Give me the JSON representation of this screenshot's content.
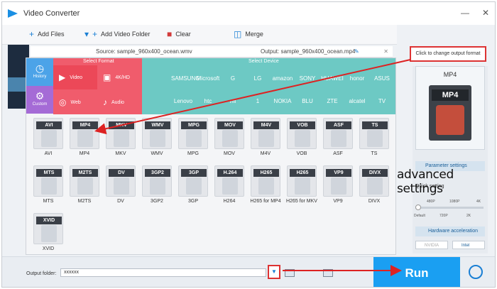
{
  "window": {
    "title": "Video Converter",
    "controls": [
      "—",
      "✕"
    ]
  },
  "toolbar": {
    "add_files": "Add Files",
    "add_video_folder": "Add Video Folder",
    "clear": "Clear",
    "merge": "Merge"
  },
  "file_row": {
    "source": "Source: sample_960x400_ocean.wmv",
    "output": "Output: sample_960x400_ocean.mp4"
  },
  "panel": {
    "select_format": "Select Format",
    "select_device": "Select Device",
    "side_tabs": [
      {
        "label": "History"
      },
      {
        "label": "Custom"
      }
    ],
    "format_tabs": [
      {
        "label": "Video",
        "icon": "video-icon"
      },
      {
        "label": "4K/HD",
        "icon": "hd-icon"
      },
      {
        "label": "Web",
        "icon": "web-icon"
      },
      {
        "label": "Audio",
        "icon": "audio-icon"
      }
    ],
    "devices": [
      "",
      "SAMSUNG",
      "Microsoft",
      "G",
      "LG",
      "amazon",
      "SONY",
      "HUAWEI",
      "honor",
      "ASUS",
      "",
      "Lenovo",
      "htc",
      "mi",
      "1",
      "NOKIA",
      "BLU",
      "ZTE",
      "alcatel",
      "TV"
    ],
    "formats": [
      {
        "tag": "AVI",
        "label": "AVI"
      },
      {
        "tag": "MP4",
        "label": "MP4"
      },
      {
        "tag": "MKV",
        "label": "MKV"
      },
      {
        "tag": "WMV",
        "label": "WMV"
      },
      {
        "tag": "MPG",
        "label": "MPG"
      },
      {
        "tag": "MOV",
        "label": "MOV"
      },
      {
        "tag": "M4V",
        "label": "M4V"
      },
      {
        "tag": "VOB",
        "label": "VOB"
      },
      {
        "tag": "ASF",
        "label": "ASF"
      },
      {
        "tag": "TS",
        "label": "TS"
      },
      {
        "tag": "MTS",
        "label": "MTS"
      },
      {
        "tag": "M2TS",
        "label": "M2TS"
      },
      {
        "tag": "DV",
        "label": "DV"
      },
      {
        "tag": "3GP2",
        "label": "3GP2"
      },
      {
        "tag": "3GP",
        "label": "3GP"
      },
      {
        "tag": "H.264",
        "label": "H264"
      },
      {
        "tag": "H265",
        "label": "H265 for MP4"
      },
      {
        "tag": "H265",
        "label": "H265 for MKV"
      },
      {
        "tag": "VP9",
        "label": "VP9"
      },
      {
        "tag": "DIVX",
        "label": "DIVX"
      },
      {
        "tag": "XVID",
        "label": "XVID"
      }
    ]
  },
  "right": {
    "hint": "Click to change output format",
    "output_format": "MP4",
    "output_tag": "MP4",
    "parameter_settings": "Parameter settings",
    "quick_setting": "Quick setting",
    "quality_top": [
      "480P",
      "1080P",
      "4K"
    ],
    "quality_bottom": [
      "Default",
      "720P",
      "2K"
    ],
    "hardware_acceleration": "Hardware acceleration",
    "gpu": [
      "NVIDIA",
      "Intel"
    ]
  },
  "annotation": {
    "advanced_settings": "advanced settings"
  },
  "bottom": {
    "output_folder_label": "Output folder:",
    "output_folder_value": "xxxxxx",
    "run": "Run"
  },
  "colors": {
    "accent": "#1a9ff2",
    "format_panel": "#f05c6c",
    "device_panel": "#6dc9c4",
    "annotation_red": "#dd2222"
  }
}
